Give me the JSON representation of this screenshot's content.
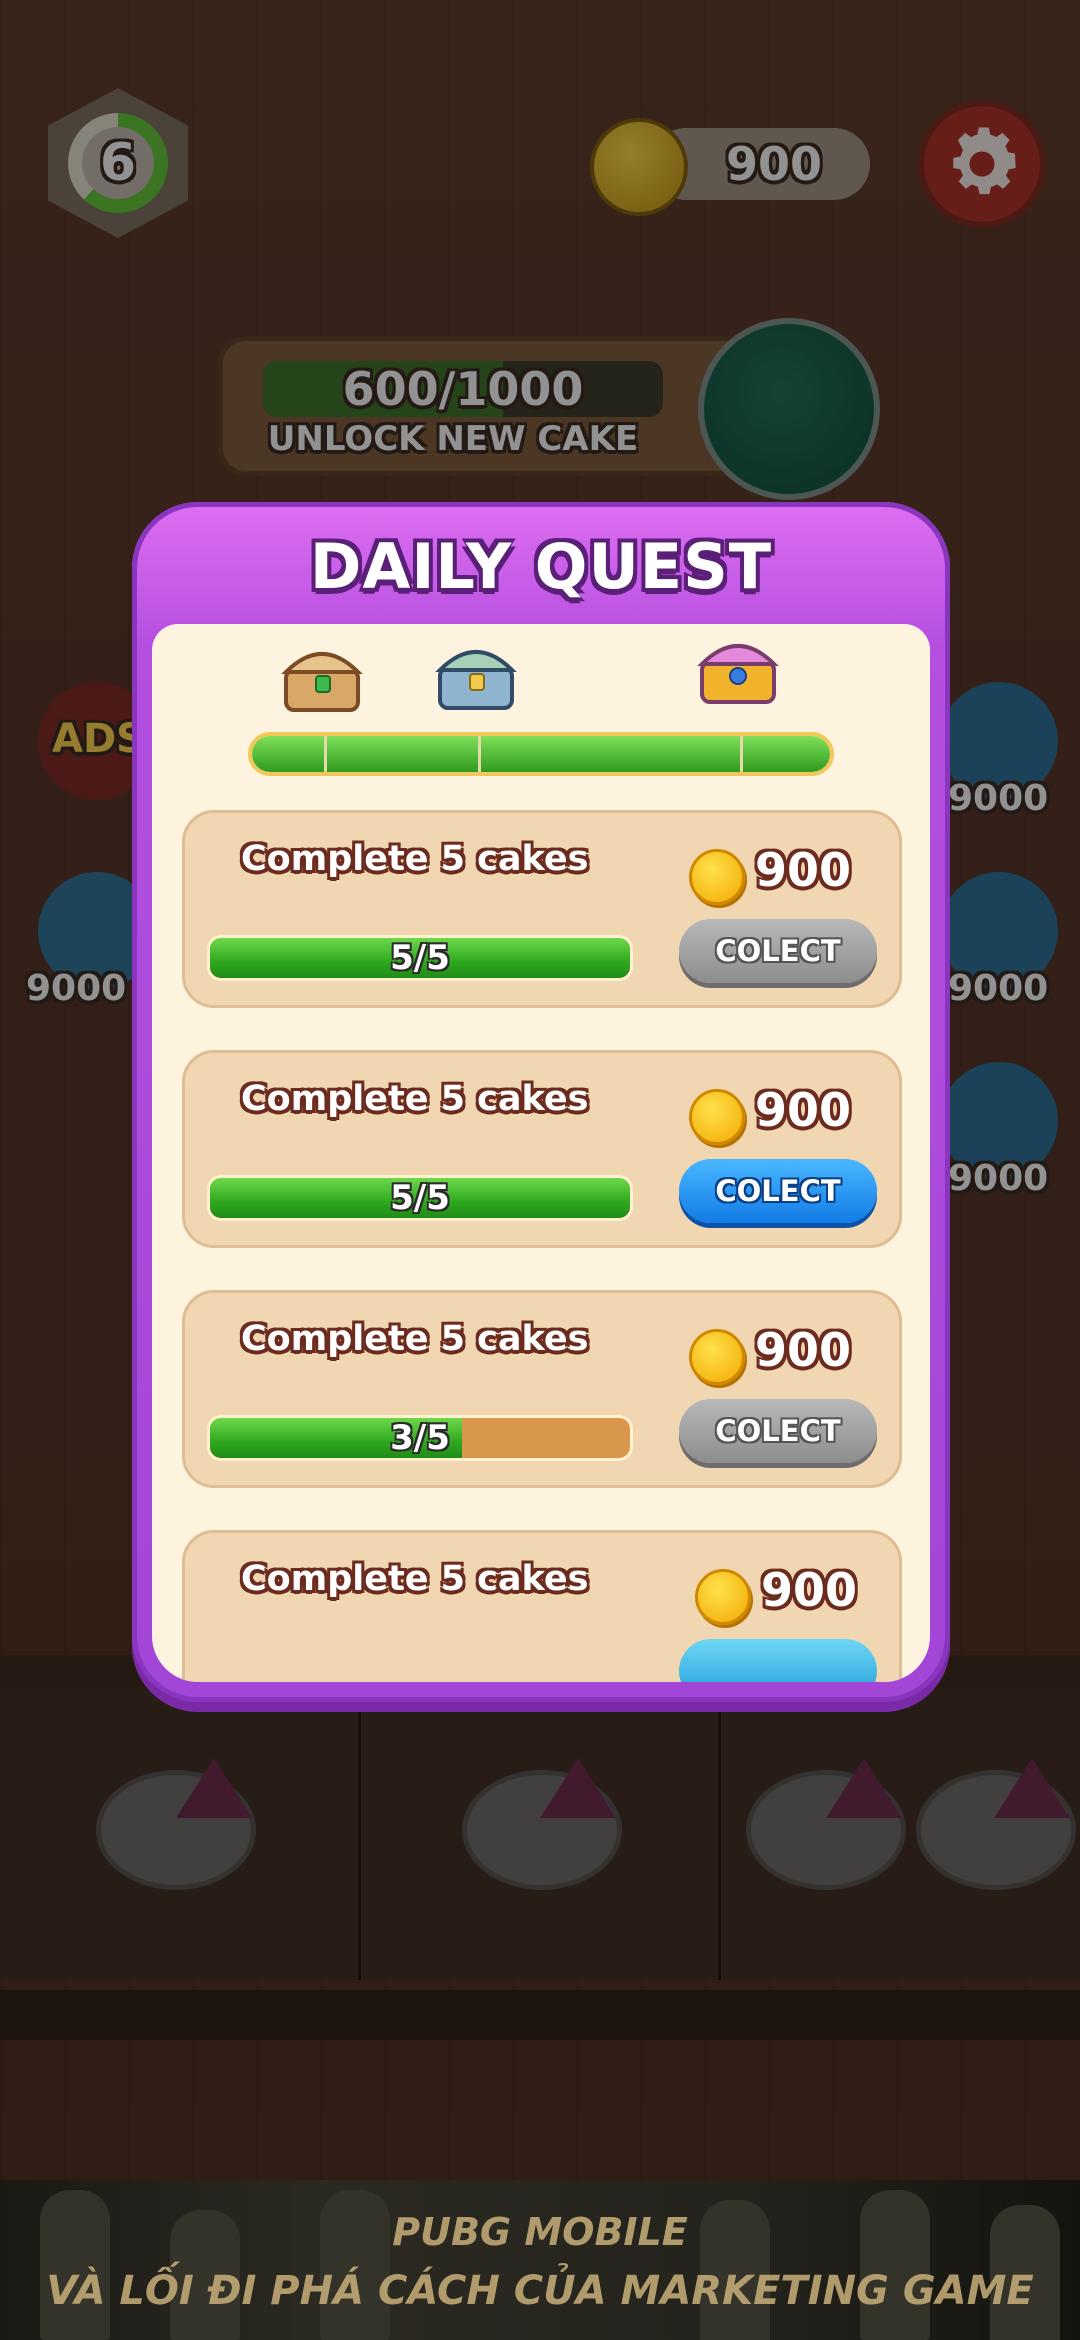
{
  "hud": {
    "level": "6",
    "level_progress": 0.62,
    "coins": "900",
    "settings_icon": "gear-icon"
  },
  "unlock": {
    "count": "600/1000",
    "progress": 0.6,
    "label": "UNLOCK NEW CAKE"
  },
  "side": {
    "left_top_label": "ADS",
    "left_bottom_label": "9000",
    "right_top_label": "9000",
    "right_middle_label": "9000",
    "right_bottom_label": "9000"
  },
  "modal": {
    "title": "DAILY QUEST",
    "milestone_progress": 1.0,
    "quests": [
      {
        "name": "Complete 5 cakes",
        "reward": "900",
        "count": "5/5",
        "progress": 1.0,
        "button": "COLECT",
        "state": "disabled"
      },
      {
        "name": "Complete 5 cakes",
        "reward": "900",
        "count": "5/5",
        "progress": 1.0,
        "button": "COLECT",
        "state": "active"
      },
      {
        "name": "Complete 5 cakes",
        "reward": "900",
        "count": "3/5",
        "progress": 0.6,
        "button": "COLECT",
        "state": "disabled"
      },
      {
        "name": "Complete 5 cakes",
        "reward": "900"
      }
    ]
  },
  "ad": {
    "title": "PUBG MOBILE",
    "subtitle": "VÀ LỐI ĐI PHÁ CÁCH CỦA MARKETING GAME"
  },
  "colors": {
    "modal_purple": "#b44fe0",
    "progress_green": "#2ea81e",
    "active_button_blue": "#137be6",
    "disabled_button_grey": "#8d8d8d",
    "coin_gold": "#f2a900"
  }
}
